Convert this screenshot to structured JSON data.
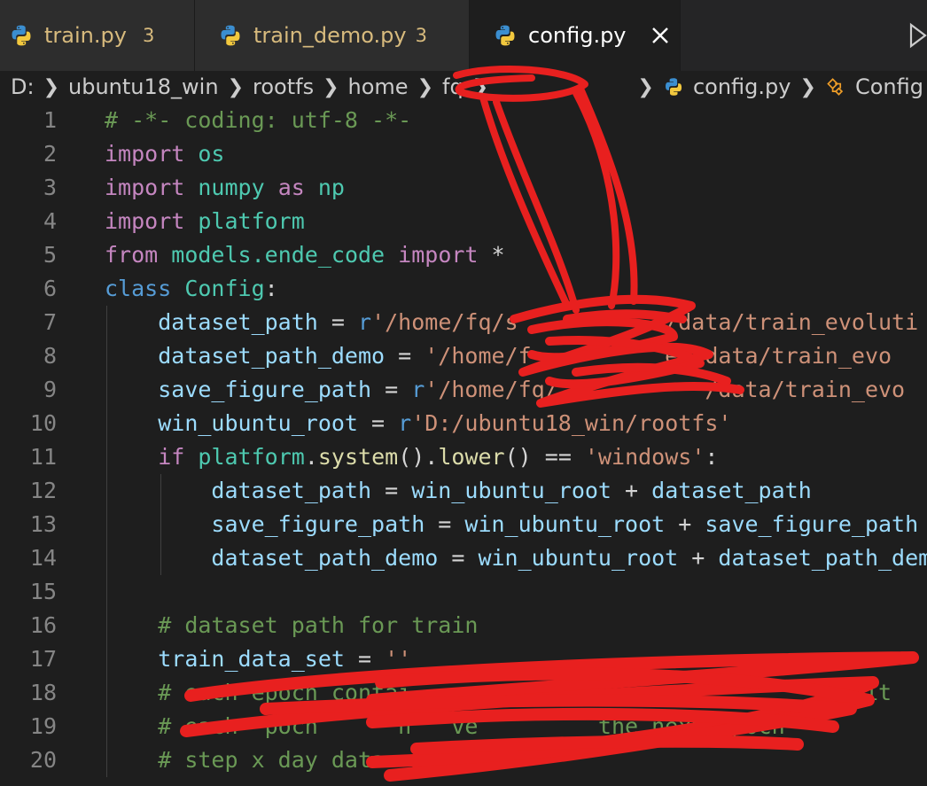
{
  "tabs": [
    {
      "label": "train.py",
      "problems": "3",
      "active": false
    },
    {
      "label": "train_demo.py",
      "problems": "3",
      "active": false
    },
    {
      "label": "config.py",
      "problems": "",
      "active": true
    }
  ],
  "breadcrumb": {
    "drive": "D:",
    "parts": [
      "ubuntu18_win",
      "rootfs",
      "home",
      "fq"
    ],
    "file": "config.py",
    "symbol": "Config"
  },
  "colors": {
    "keyword": "#c586c0",
    "keyword_blue": "#569cd6",
    "class": "#4ec9b0",
    "variable": "#9cdcfe",
    "function": "#dcdcaa",
    "string": "#ce9178",
    "comment": "#6a9955",
    "redaction": "#e8201f"
  },
  "icons": {
    "tab_file_icon": "python-icon",
    "close": "close-icon",
    "run": "run-icon",
    "symbol": "class-symbol-icon"
  },
  "code": {
    "line_numbers": [
      "1",
      "2",
      "3",
      "4",
      "5",
      "6",
      "7",
      "8",
      "9",
      "10",
      "11",
      "12",
      "13",
      "14",
      "15",
      "16",
      "17",
      "18",
      "19",
      "20"
    ],
    "lines": [
      {
        "tokens": [
          [
            "cmt",
            "# -*- coding: utf-8 -*-"
          ]
        ]
      },
      {
        "tokens": [
          [
            "kw",
            "import"
          ],
          [
            "op",
            " "
          ],
          [
            "mod",
            "os"
          ]
        ]
      },
      {
        "tokens": [
          [
            "kw",
            "import"
          ],
          [
            "op",
            " "
          ],
          [
            "mod",
            "numpy"
          ],
          [
            "op",
            " "
          ],
          [
            "kw",
            "as"
          ],
          [
            "op",
            " "
          ],
          [
            "mod",
            "np"
          ]
        ]
      },
      {
        "tokens": [
          [
            "kw",
            "import"
          ],
          [
            "op",
            " "
          ],
          [
            "mod",
            "platform"
          ]
        ]
      },
      {
        "tokens": [
          [
            "kw",
            "from"
          ],
          [
            "op",
            " "
          ],
          [
            "mod",
            "models.ende_code"
          ],
          [
            "op",
            " "
          ],
          [
            "kw",
            "import"
          ],
          [
            "op",
            " *"
          ]
        ]
      },
      {
        "tokens": [
          [
            "kwb",
            "class"
          ],
          [
            "op",
            " "
          ],
          [
            "cls",
            "Config"
          ],
          [
            "op",
            ":"
          ]
        ]
      },
      {
        "tokens": [
          [
            "op",
            "    "
          ],
          [
            "var",
            "dataset_path"
          ],
          [
            "op",
            " = "
          ],
          [
            "kwb",
            "r"
          ],
          [
            "str",
            "'/home/fq/s          c/data/train_evoluti"
          ]
        ]
      },
      {
        "tokens": [
          [
            "op",
            "    "
          ],
          [
            "var",
            "dataset_path_demo"
          ],
          [
            "op",
            " = "
          ],
          [
            "str",
            "'/home/f          er/data/train_evo"
          ]
        ]
      },
      {
        "tokens": [
          [
            "op",
            "    "
          ],
          [
            "var",
            "save_figure_path"
          ],
          [
            "op",
            " = "
          ],
          [
            "kwb",
            "r"
          ],
          [
            "str",
            "'/home/fq/           /data/train_evo"
          ]
        ]
      },
      {
        "tokens": [
          [
            "op",
            "    "
          ],
          [
            "var",
            "win_ubuntu_root"
          ],
          [
            "op",
            " = "
          ],
          [
            "kwb",
            "r"
          ],
          [
            "str",
            "'D:/ubuntu18_win/rootfs'"
          ]
        ]
      },
      {
        "tokens": [
          [
            "op",
            "    "
          ],
          [
            "kw",
            "if"
          ],
          [
            "op",
            " "
          ],
          [
            "mod",
            "platform"
          ],
          [
            "op",
            "."
          ],
          [
            "fn",
            "system"
          ],
          [
            "op",
            "()."
          ],
          [
            "fn",
            "lower"
          ],
          [
            "op",
            "() == "
          ],
          [
            "str",
            "'windows'"
          ],
          [
            "op",
            ":"
          ]
        ]
      },
      {
        "tokens": [
          [
            "op",
            "        "
          ],
          [
            "var",
            "dataset_path"
          ],
          [
            "op",
            " = "
          ],
          [
            "var",
            "win_ubuntu_root"
          ],
          [
            "op",
            " + "
          ],
          [
            "var",
            "dataset_path"
          ]
        ]
      },
      {
        "tokens": [
          [
            "op",
            "        "
          ],
          [
            "var",
            "save_figure_path"
          ],
          [
            "op",
            " = "
          ],
          [
            "var",
            "win_ubuntu_root"
          ],
          [
            "op",
            " + "
          ],
          [
            "var",
            "save_figure_path"
          ]
        ]
      },
      {
        "tokens": [
          [
            "op",
            "        "
          ],
          [
            "var",
            "dataset_path_demo"
          ],
          [
            "op",
            " = "
          ],
          [
            "var",
            "win_ubuntu_root"
          ],
          [
            "op",
            " + "
          ],
          [
            "var",
            "dataset_path_demo"
          ]
        ]
      },
      {
        "tokens": []
      },
      {
        "tokens": [
          [
            "op",
            "    "
          ],
          [
            "cmt",
            "# dataset path for train"
          ]
        ]
      },
      {
        "tokens": [
          [
            "op",
            "    "
          ],
          [
            "var",
            "train_data_set"
          ],
          [
            "op",
            " = "
          ],
          [
            "str",
            "''"
          ]
        ]
      },
      {
        "tokens": [
          [
            "op",
            "    "
          ],
          [
            "cmt",
            "# each epoch contai                                 fit"
          ]
        ]
      },
      {
        "tokens": [
          [
            "op",
            "    "
          ],
          [
            "cmt",
            "# each  poch      n   ve         the next epoch"
          ]
        ]
      },
      {
        "tokens": [
          [
            "op",
            "    "
          ],
          [
            "cmt",
            "# step x day data"
          ]
        ]
      }
    ]
  }
}
